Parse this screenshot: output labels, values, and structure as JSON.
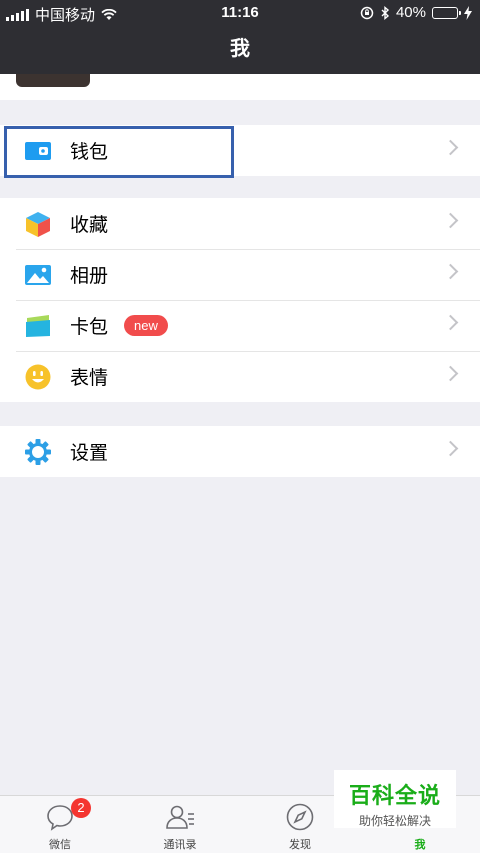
{
  "status": {
    "carrier": "中国移动",
    "time": "11:16",
    "battery": "40%",
    "battery_level": 0.4
  },
  "nav": {
    "title": "我"
  },
  "menu": {
    "wallet": "钱包",
    "favorites": "收藏",
    "album": "相册",
    "cards": "卡包",
    "cards_badge": "new",
    "stickers": "表情",
    "settings": "设置"
  },
  "tabs": [
    {
      "label": "微信",
      "badge": "2"
    },
    {
      "label": "通讯录"
    },
    {
      "label": "发现"
    },
    {
      "label": "我"
    }
  ],
  "watermark": {
    "title": "百科全说",
    "subtitle": "助你轻松解决"
  },
  "colors": {
    "accent": "#1aad19",
    "bar": "#2e2e33",
    "badge": "#f43530",
    "highlight": "#3760ad"
  }
}
